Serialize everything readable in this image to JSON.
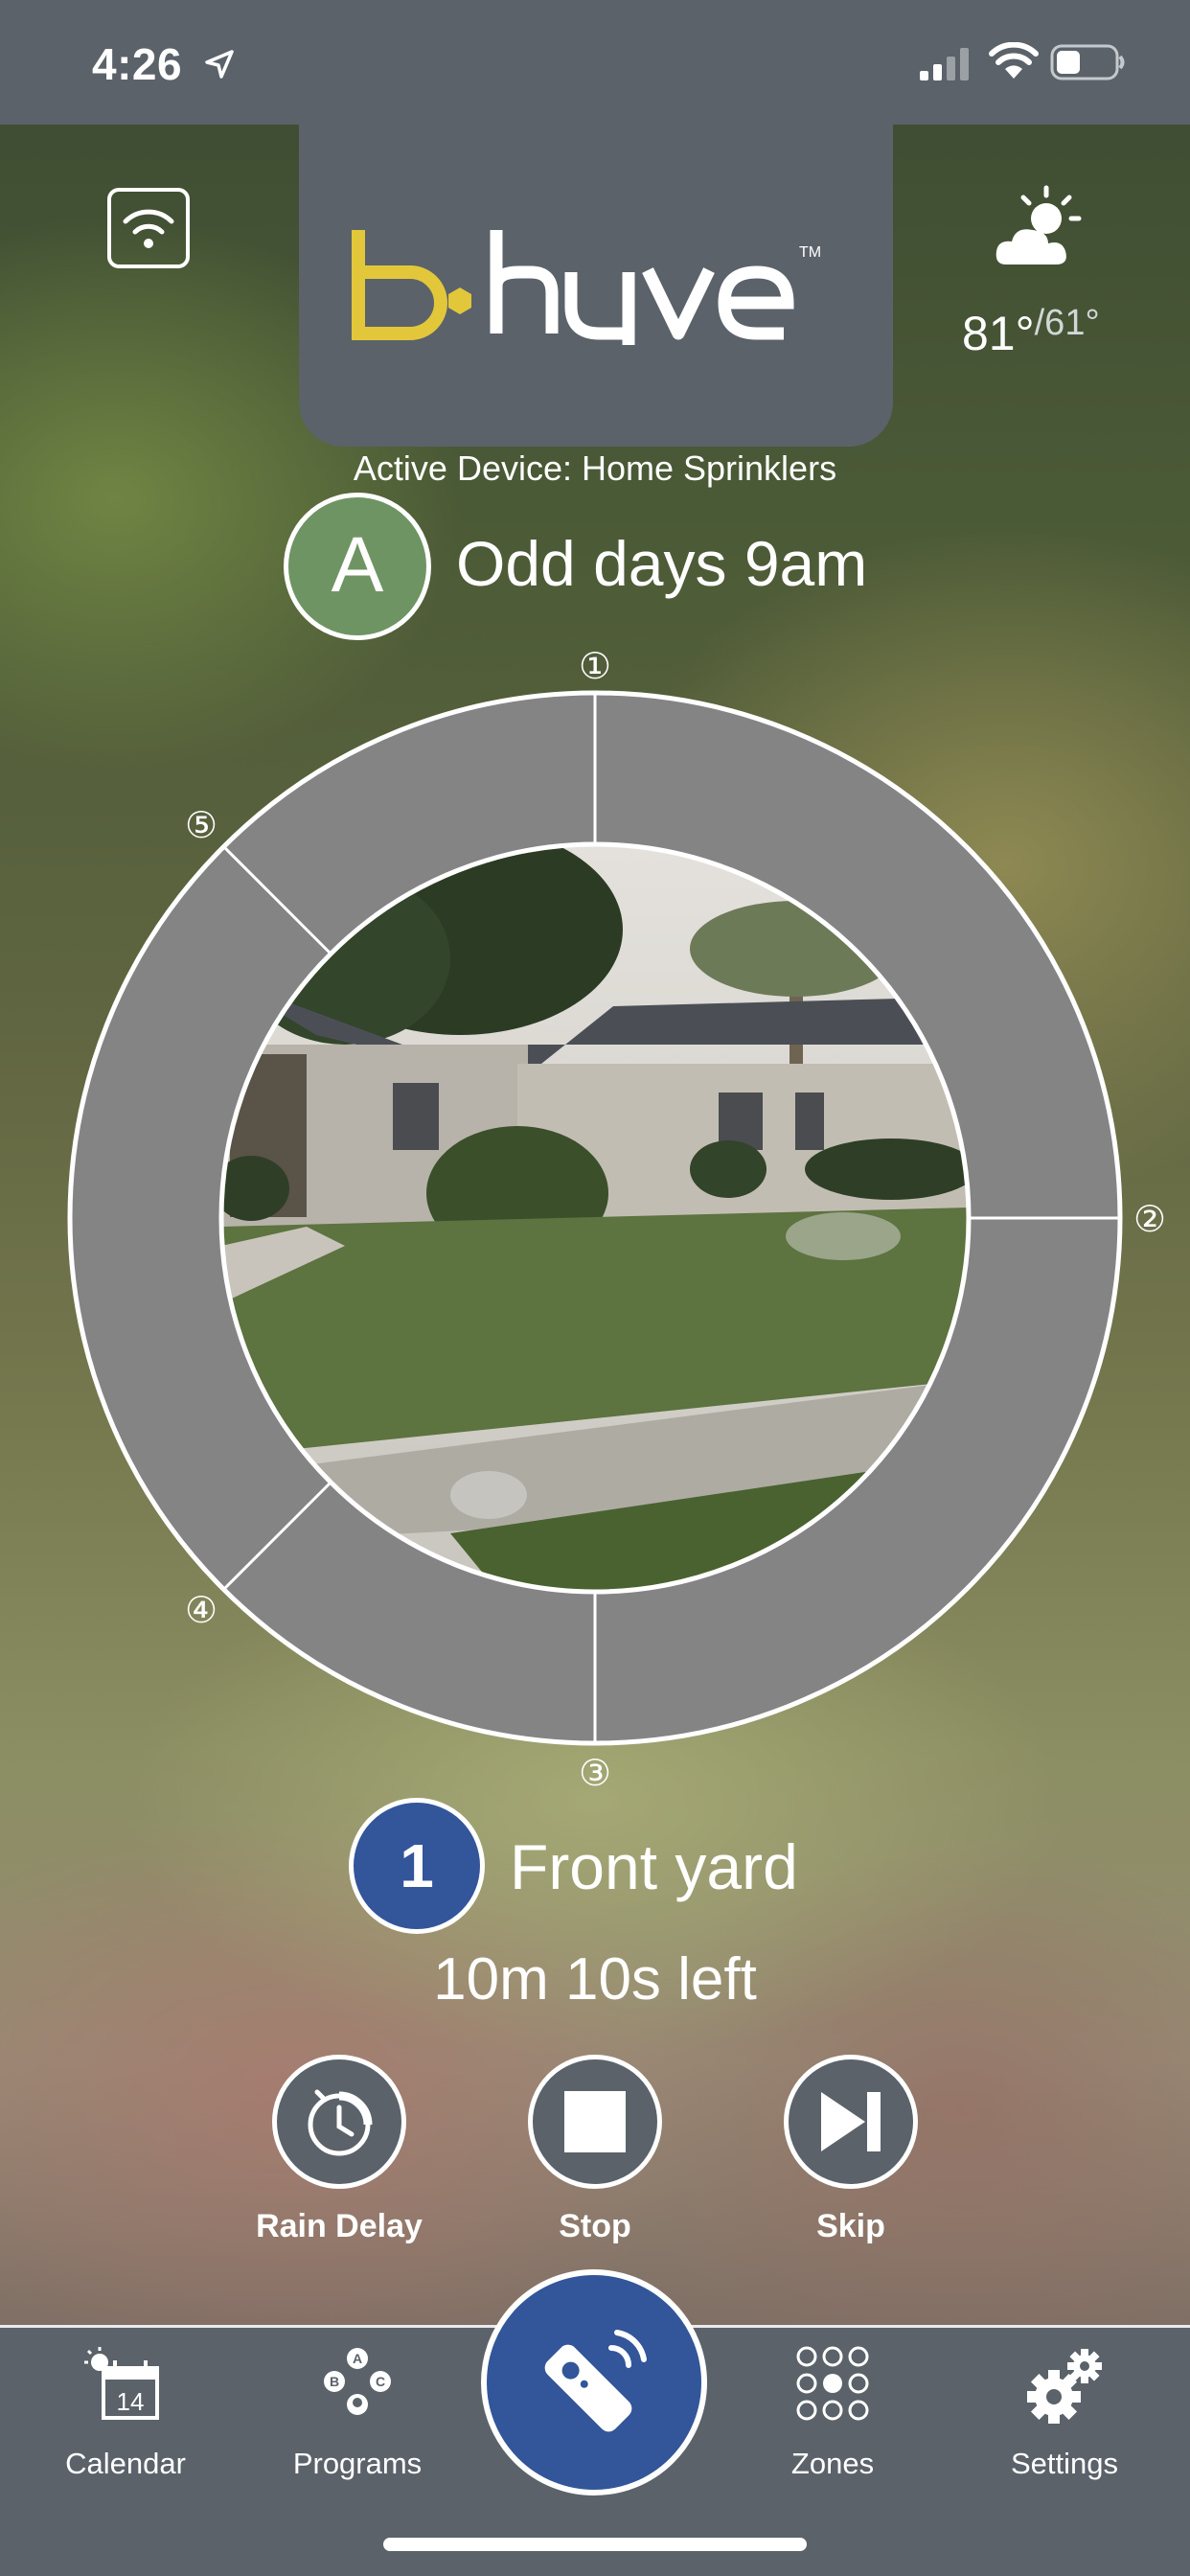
{
  "status_bar": {
    "time": "4:26"
  },
  "header": {
    "logo_text": "b·hyve™",
    "temp_high": "81°",
    "temp_low": "/61°",
    "active_device": "Active Device: Home Sprinklers"
  },
  "program": {
    "letter": "A",
    "name": "Odd days 9am"
  },
  "dial": {
    "zone_markers": [
      "①",
      "②",
      "③",
      "④",
      "⑤"
    ]
  },
  "current_zone": {
    "number": "1",
    "name": "Front yard",
    "time_left": "10m 10s left"
  },
  "actions": [
    {
      "label": "Rain Delay",
      "icon": "rain-delay-clock-icon"
    },
    {
      "label": "Stop",
      "icon": "stop-icon"
    },
    {
      "label": "Skip",
      "icon": "skip-icon"
    }
  ],
  "tabs": [
    {
      "label": "Calendar",
      "icon": "calendar-icon",
      "date": "14"
    },
    {
      "label": "Programs",
      "icon": "programs-icon"
    },
    {
      "label": "Remote",
      "icon": "remote-icon"
    },
    {
      "label": "Zones",
      "icon": "zones-icon"
    },
    {
      "label": "Settings",
      "icon": "gear-icon"
    }
  ],
  "program_badges": [
    "A",
    "B",
    "C"
  ],
  "colors": {
    "bar": "#5b626a",
    "program_green": "#6f9463",
    "zone_blue": "#335599",
    "logo_yellow": "#e2c73a",
    "dial_gray": "#848484"
  }
}
